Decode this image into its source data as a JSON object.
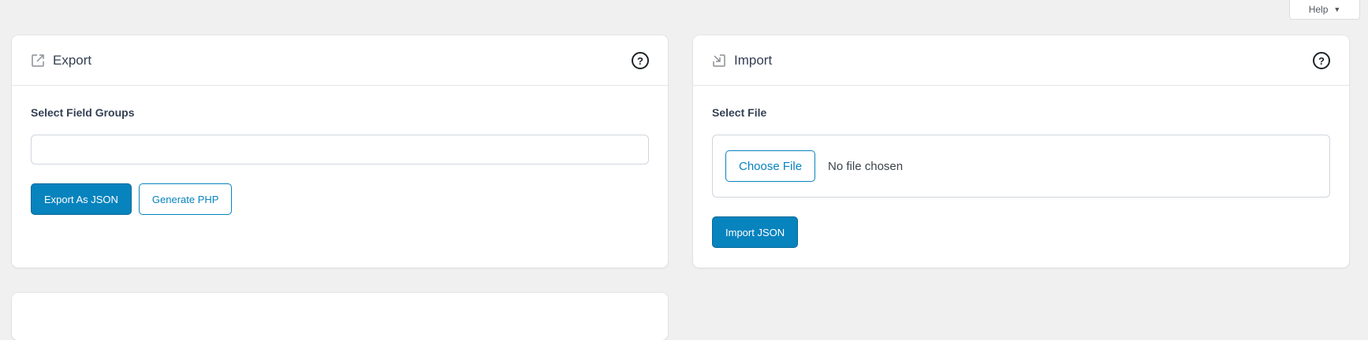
{
  "help": {
    "label": "Help",
    "caret": "▼"
  },
  "export": {
    "title": "Export",
    "icon": "export-icon",
    "help_icon": "?",
    "field_label": "Select Field Groups",
    "select_value": "",
    "buttons": {
      "json": "Export As JSON",
      "php": "Generate PHP"
    }
  },
  "import": {
    "title": "Import",
    "icon": "import-icon",
    "help_icon": "?",
    "file_label": "Select File",
    "choose_file": "Choose File",
    "no_file": "No file chosen",
    "button": "Import JSON"
  },
  "colors": {
    "primary": "#0783be",
    "background": "#f0f0f1",
    "panel": "#ffffff",
    "border": "#d0d5dd"
  }
}
